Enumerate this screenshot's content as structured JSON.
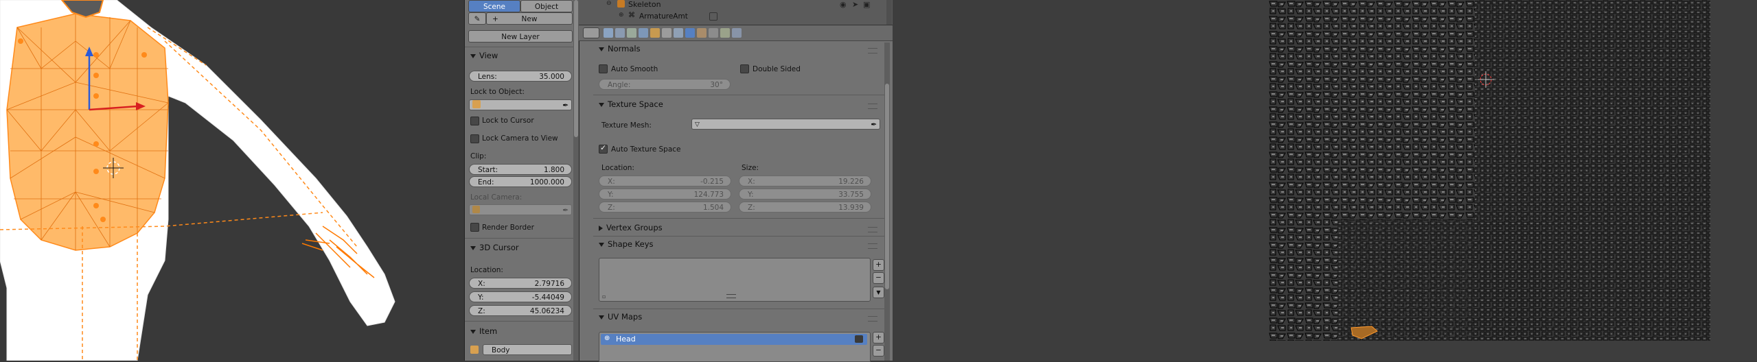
{
  "viewport": {
    "orange": "#ff9a2e",
    "mesh_fill": "#ffae4f",
    "white": "#ffffff",
    "bg": "#393939"
  },
  "npanel": {
    "scene_tabs": [
      "Scene",
      "Object"
    ],
    "new_label": "New",
    "new_layer_label": "New Layer",
    "view": {
      "title": "View",
      "lens_label": "Lens:",
      "lens_value": "35.000",
      "lock_to_object": "Lock to Object:",
      "lock_to_cursor": "Lock to Cursor",
      "lock_camera": "Lock Camera to View",
      "clip": "Clip:",
      "start_label": "Start:",
      "start_value": "1.800",
      "end_label": "End:",
      "end_value": "1000.000",
      "local_camera": "Local Camera:",
      "render_border": "Render Border"
    },
    "cursor": {
      "title": "3D Cursor",
      "location": "Location:",
      "x_label": "X:",
      "x_value": "2.79716",
      "y_label": "Y:",
      "y_value": "-5.44049",
      "z_label": "Z:",
      "z_value": "45.06234"
    },
    "item": {
      "title": "Item",
      "name": "Body"
    }
  },
  "outliner": {
    "row1": "Skeleton",
    "row2": "ArmatureAmt"
  },
  "props": {
    "normals": {
      "title": "Normals",
      "auto_smooth": "Auto Smooth",
      "double_sided": "Double Sided",
      "angle_label": "Angle:",
      "angle_value": "30°"
    },
    "texture_space": {
      "title": "Texture Space",
      "texture_mesh": "Texture Mesh:",
      "auto_texture_space": "Auto Texture Space",
      "location": "Location:",
      "size": "Size:",
      "loc_x": "-0.215",
      "loc_y": "124.773",
      "loc_z": "1.504",
      "size_x": "19.226",
      "size_y": "33.755",
      "size_z": "13.939",
      "x": "X:",
      "y": "Y:",
      "z": "Z:"
    },
    "vertex_groups": {
      "title": "Vertex Groups"
    },
    "shape_keys": {
      "title": "Shape Keys"
    },
    "uv_maps": {
      "title": "UV Maps",
      "active_map": "Head"
    },
    "accent": "#5680c2"
  }
}
